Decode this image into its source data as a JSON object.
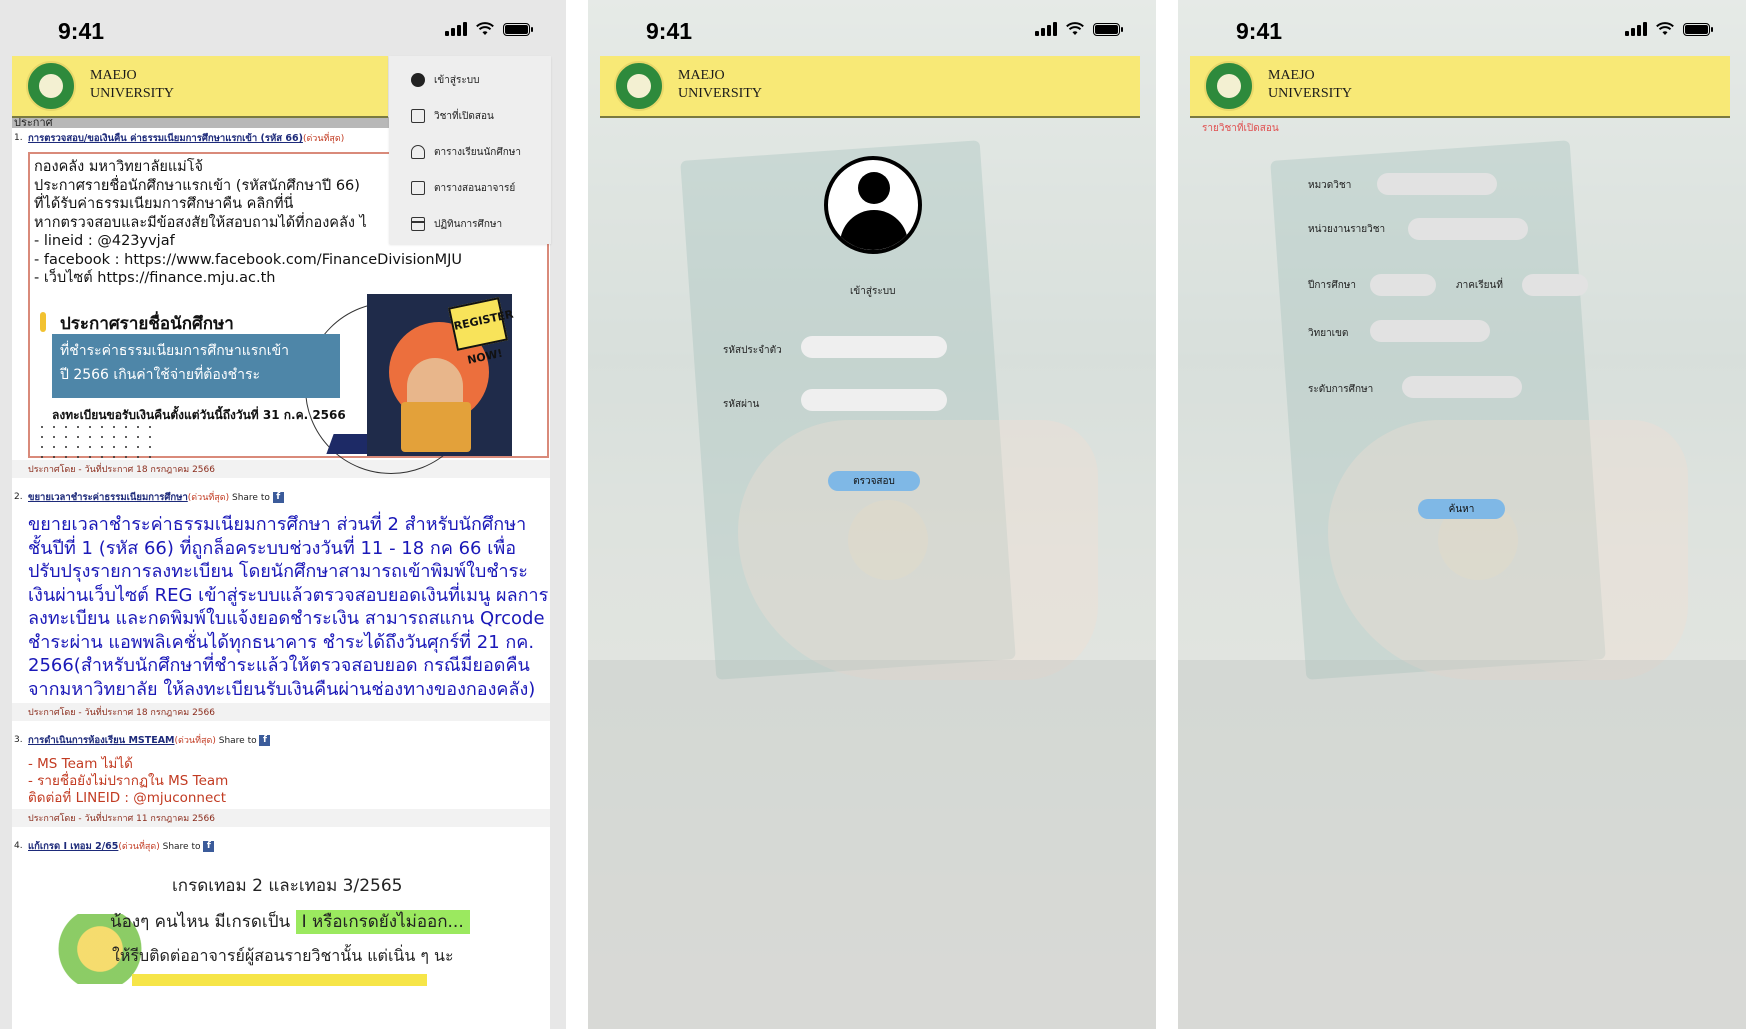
{
  "status": {
    "time": "9:41"
  },
  "brand": {
    "line1": "MAEJO",
    "line2": "UNIVERSITY"
  },
  "screen1": {
    "menu": [
      {
        "label": "เข้าสู่ระบบ",
        "icon": "user-circle-icon"
      },
      {
        "label": "วิชาที่เปิดสอน",
        "icon": "course-icon"
      },
      {
        "label": "ตารางเรียนนักศึกษา",
        "icon": "people-icon"
      },
      {
        "label": "ตารางสอนอาจารย์",
        "icon": "schedule-icon"
      },
      {
        "label": "ปฏิทินการศึกษา",
        "icon": "calendar-icon"
      }
    ],
    "section_title": "ประกาศ",
    "announcements": [
      {
        "num": "1.",
        "title": "การตรวจสอบ/ขอเงินคืน ค่าธรรมเนียมการศึกษาแรกเข้า (รหัส 66)",
        "urgent": "(ด่วนที่สุด)",
        "lines": [
          "กองคลัง มหาวิทยาลัยแม่โจ้",
          "ประกาศรายชื่อนักศึกษาแรกเข้า (รหัสนักศึกษาปี 66)",
          "ที่ได้รับค่าธรรมเนียมการศึกษาคืน คลิกที่นี่",
          "หากตรวจสอบและมีข้อสงสัยให้สอบถามได้ที่กองคลัง ไ",
          "- lineid : @423yvjaf",
          "- facebook : https://www.facebook.com/FinanceDivisionMJU",
          "- เว็บไซต์ https://finance.mju.ac.th"
        ],
        "banner_title": "ประกาศรายชื่อนักศึกษา",
        "banner_blue_1": "ที่ชำระค่าธรรมเนียมการศึกษาแรกเข้า",
        "banner_blue_2": "ปี 2566 เกินค่าใช้จ่ายที่ต้องชำระ",
        "banner_sub": "ลงทะเบียนขอรับเงินคืนตั้งแต่วันนี้ถึงวันที่ 31 ก.ค. 2566",
        "poster_badge": "REGISTER NOW!",
        "meta": "ประกาศโดย   -   วันที่ประกาศ   18 กรกฎาคม 2566"
      },
      {
        "num": "2.",
        "title": "ขยายเวลาชำระค่าธรรมเนียมการศึกษา",
        "urgent": "(ด่วนที่สุด)",
        "share": "Share to",
        "body": "ขยายเวลาชำระค่าธรรมเนียมการศึกษา ส่วนที่ 2 สำหรับนักศึกษาชั้นปีที่ 1 (รหัส 66) ที่ถูกล็อคระบบช่วงวันที่ 11 - 18 กค 66 เพื่อปรับปรุงรายการลงทะเบียน โดยนักศึกษาสามารถเข้าพิมพ์ใบชำระเงินผ่านเว็บไซต์ REG เข้าสู่ระบบแล้วตรวจสอบยอดเงินที่เมนู ผลการลงทะเบียน และกดพิมพ์ใบแจ้งยอดชำระเงิน สามารถสแกน Qrcode ชำระผ่าน แอพพลิเคชั่นได้ทุกธนาคาร ชำระได้ถึงวันศุกร์ที่ 21 กค. 2566(สำหรับนักศึกษาที่ชำระแล้วให้ตรวจสอบยอด กรณีมียอดคืนจากมหาวิทยาลัย ให้ลงทะเบียนรับเงินคืนผ่านช่องทางของกองคลัง)",
        "meta": "ประกาศโดย   -   วันที่ประกาศ   18 กรกฎาคม 2566"
      },
      {
        "num": "3.",
        "title": "การดำเนินการห้องเรียน MSTEAM",
        "urgent": "(ด่วนที่สุด)",
        "share": "Share to",
        "lines": [
          "- MS Team ไม่ได้",
          "- รายชื่อยังไม่ปรากฏใน MS Team",
          "ติดต่อที่ LINEID : @mjuconnect"
        ],
        "meta": "ประกาศโดย   -   วันที่ประกาศ   11 กรกฎาคม 2566"
      },
      {
        "num": "4.",
        "title": "แก้เกรด I เทอม 2/65",
        "urgent": "(ด่วนที่สุด)",
        "share": "Share to",
        "img_line1": "เกรดเทอม 2 และเทอม 3/2565",
        "img_line2a": "น้องๆ คนไหน มีเกรดเป็น",
        "img_line2b": "I หรือเกรดยังไม่ออก...",
        "img_line3": "ให้รีบติดต่ออาจารย์ผู้สอนรายวิชานั้น แต่เนิ่น ๆ นะ"
      }
    ]
  },
  "screen2": {
    "login_title": "เข้าสู่ระบบ",
    "id_label": "รหัสประจำตัว",
    "id_value": "",
    "password_label": "รหัสผ่าน",
    "password_value": "",
    "submit_label": "ตรวจสอบ"
  },
  "screen3": {
    "breadcrumb": "รายวิชาที่เปิดสอน",
    "fields": {
      "category": "หมวดวิชา",
      "department": "หน่วยงานรายวิชา",
      "year": "ปีการศึกษา",
      "semester": "ภาคเรียนที่",
      "campus": "วิทยาเขต",
      "level": "ระดับการศึกษา"
    },
    "search_label": "ค้นหา"
  }
}
